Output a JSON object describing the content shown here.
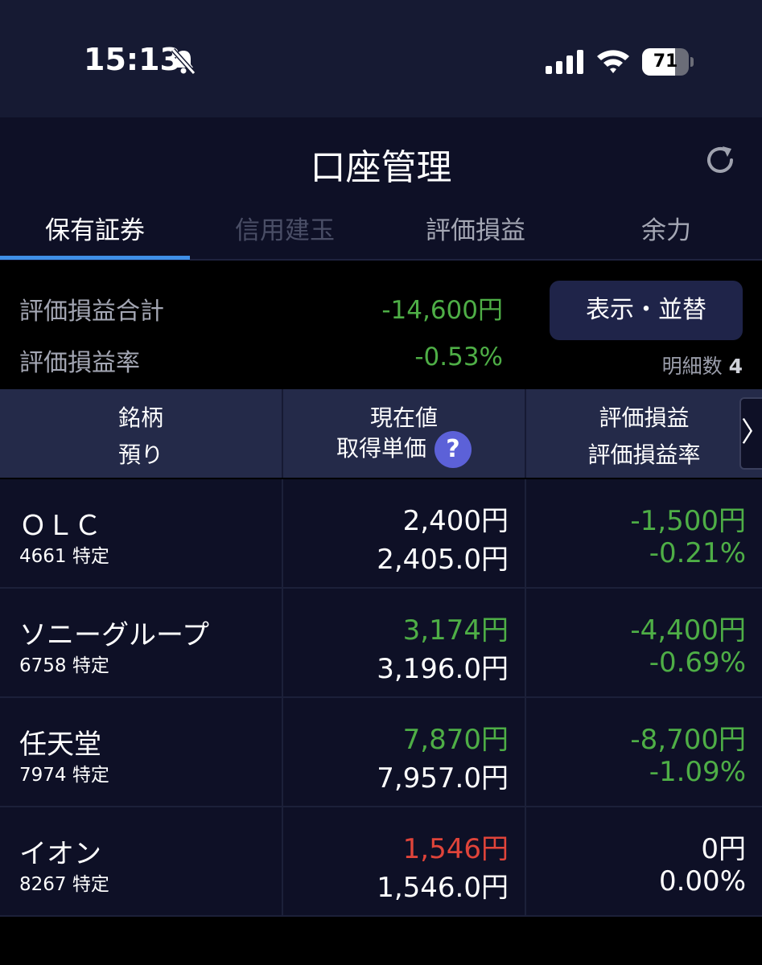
{
  "status_bar": {
    "time": "15:13",
    "battery": "71",
    "battery_level": 0.71,
    "icons": [
      "bell-slash-icon",
      "cellular-signal-icon",
      "wifi-icon",
      "battery-icon"
    ]
  },
  "header": {
    "title": "口座管理",
    "refresh_icon": "refresh-icon"
  },
  "tabs": [
    {
      "label": "保有証券",
      "state": "active"
    },
    {
      "label": "信用建玉",
      "state": "disabled"
    },
    {
      "label": "評価損益",
      "state": "normal"
    },
    {
      "label": "余力",
      "state": "normal"
    }
  ],
  "summary": {
    "total_label": "評価損益合計",
    "total_value": "-14,600円",
    "rate_label": "評価損益率",
    "rate_value": "-0.53%",
    "sort_button": "表示・並替",
    "count_label": "明細数",
    "count_value": "4"
  },
  "table": {
    "headers": [
      {
        "line1": "銘柄",
        "line2": "預り"
      },
      {
        "line1": "現在値",
        "line2": "取得単価"
      },
      {
        "line1": "評価損益",
        "line2": "評価損益率"
      }
    ],
    "help_icon": "?",
    "scroll_icon": "〉",
    "rows": [
      {
        "name": "ＯＬＣ",
        "code": "4661 特定",
        "price": "2,400円",
        "cost": "2,405.0円",
        "pl": "-1,500円",
        "rate": "-0.21%",
        "price_color": "#ffffff",
        "pl_color": "#4eae46"
      },
      {
        "name": "ソニーグループ",
        "code": "6758 特定",
        "price": "3,174円",
        "cost": "3,196.0円",
        "pl": "-4,400円",
        "rate": "-0.69%",
        "price_color": "#4eae46",
        "pl_color": "#4eae46"
      },
      {
        "name": "任天堂",
        "code": "7974 特定",
        "price": "7,870円",
        "cost": "7,957.0円",
        "pl": "-8,700円",
        "rate": "-1.09%",
        "price_color": "#4eae46",
        "pl_color": "#4eae46"
      },
      {
        "name": "イオン",
        "code": "8267 特定",
        "price": "1,546円",
        "cost": "1,546.0円",
        "pl": "0円",
        "rate": "0.00%",
        "price_color": "#e0443a",
        "pl_color": "#ffffff"
      }
    ]
  },
  "colors": {
    "loss": "#4eae46",
    "gain": "#e0443a",
    "accent": "#3f8fe6",
    "tab_active": "#ffffff",
    "tab_disabled": "#4a4e66",
    "tab_normal": "#a4a7b4"
  }
}
